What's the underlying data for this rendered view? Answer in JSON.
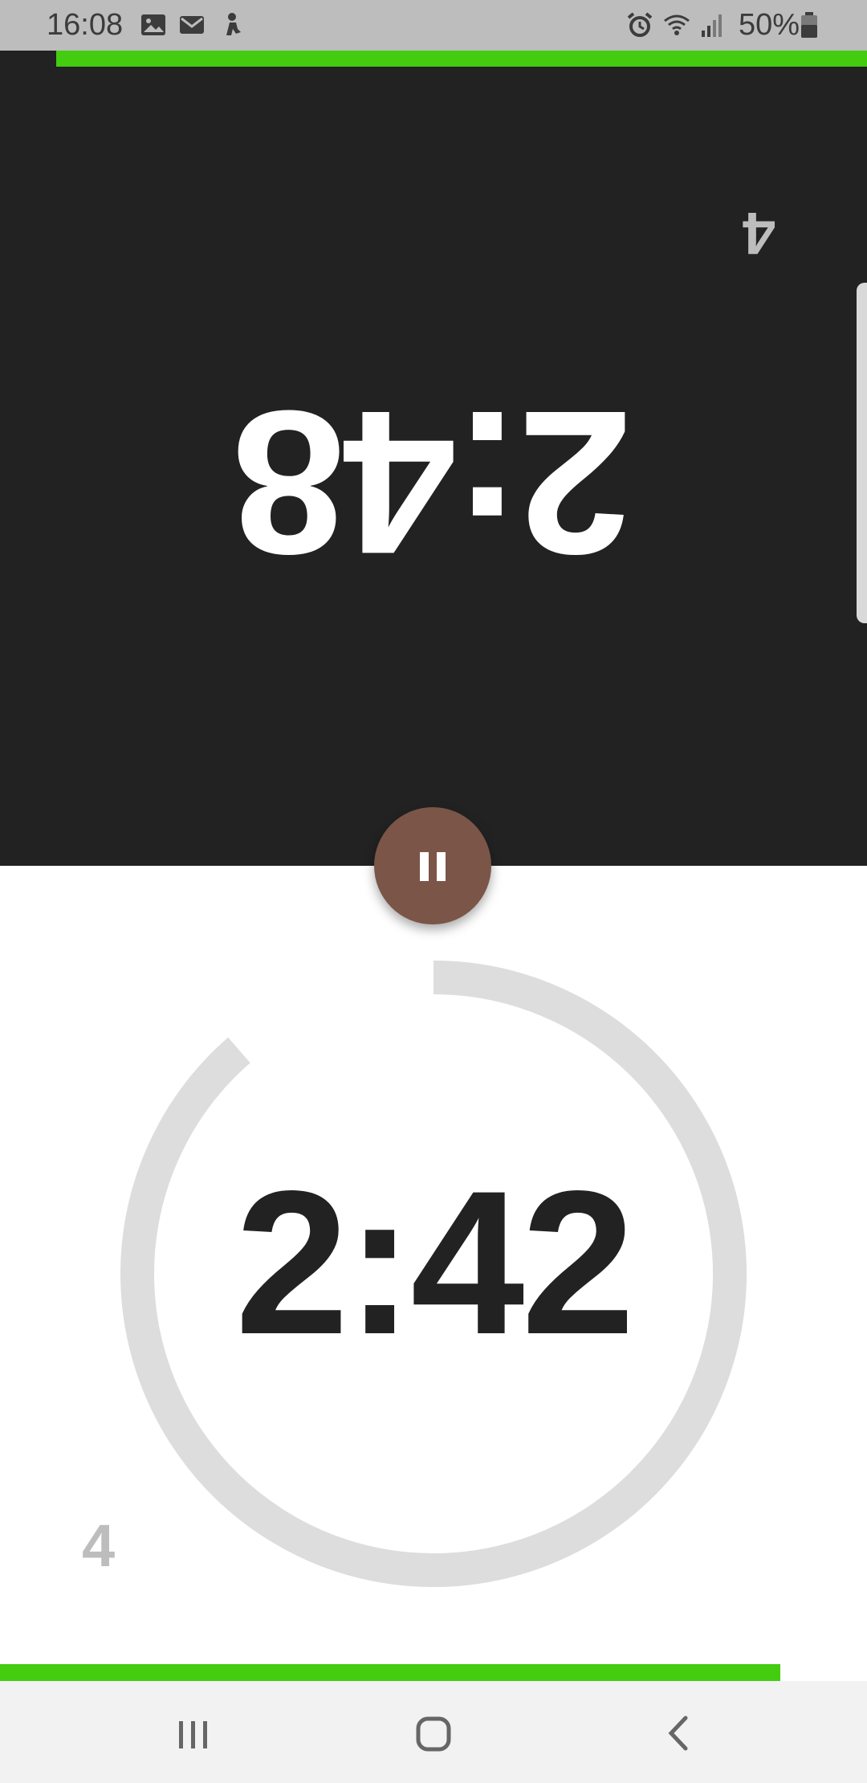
{
  "status_bar": {
    "time": "16:08",
    "battery": "50%",
    "icons": [
      "image-icon",
      "mail-icon",
      "person-icon",
      "alarm-icon",
      "wifi-icon",
      "signal-icon",
      "battery-icon"
    ]
  },
  "players": {
    "top": {
      "time": "2:48",
      "moves": "4",
      "progress_fraction": 0.935
    },
    "bottom": {
      "time": "2:42",
      "moves": "4",
      "progress_fraction": 0.9
    }
  },
  "controls": {
    "pause_icon": "pause-icon"
  },
  "nav_bar": {
    "buttons": [
      "recents-icon",
      "home-icon",
      "back-icon"
    ]
  },
  "colors": {
    "progress": "#44cc11",
    "dark_panel": "#222222",
    "pause_button": "#7a5548",
    "ring": "#dddddd",
    "moves_text": "#bdbdbd"
  }
}
